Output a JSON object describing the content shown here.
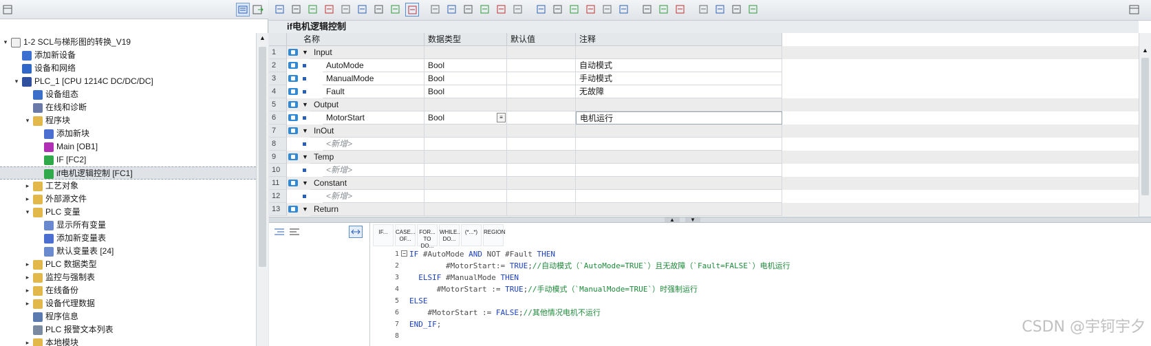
{
  "left_pane": {
    "tree": [
      {
        "label": "1-2 SCL与梯形图的转换_V19",
        "level": 0,
        "expander": "▾",
        "icon": "project-icon",
        "icon_color": "#f0f0f0"
      },
      {
        "label": "添加新设备",
        "level": 1,
        "expander": "",
        "icon": "add-device-icon",
        "icon_color": "#3b6fd0"
      },
      {
        "label": "设备和网络",
        "level": 1,
        "expander": "",
        "icon": "network-icon",
        "icon_color": "#2f68c8"
      },
      {
        "label": "PLC_1 [CPU 1214C DC/DC/DC]",
        "level": 1,
        "expander": "▾",
        "icon": "plc-icon",
        "icon_color": "#2f4f9f"
      },
      {
        "label": "设备组态",
        "level": 2,
        "expander": "",
        "icon": "device-config-icon",
        "icon_color": "#3c6fc9"
      },
      {
        "label": "在线和诊断",
        "level": 2,
        "expander": "",
        "icon": "diagnostics-icon",
        "icon_color": "#6a7aa8"
      },
      {
        "label": "程序块",
        "level": 2,
        "expander": "▾",
        "icon": "folder-icon",
        "icon_color": "#e2b84a"
      },
      {
        "label": "添加新块",
        "level": 3,
        "expander": "",
        "icon": "add-block-icon",
        "icon_color": "#4a6fd0"
      },
      {
        "label": "Main [OB1]",
        "level": 3,
        "expander": "",
        "icon": "ob-block-icon",
        "icon_color": "#b02fb5"
      },
      {
        "label": "IF [FC2]",
        "level": 3,
        "expander": "",
        "icon": "fc-block-icon",
        "icon_color": "#2fa94a"
      },
      {
        "label": "if电机逻辑控制 [FC1]",
        "level": 3,
        "expander": "",
        "icon": "fc-block-icon",
        "icon_color": "#2fa94a",
        "selected": true
      },
      {
        "label": "工艺对象",
        "level": 2,
        "expander": "▸",
        "icon": "folder-icon",
        "icon_color": "#e2b84a"
      },
      {
        "label": "外部源文件",
        "level": 2,
        "expander": "▸",
        "icon": "folder-icon",
        "icon_color": "#e2b84a"
      },
      {
        "label": "PLC 变量",
        "level": 2,
        "expander": "▾",
        "icon": "folder-icon",
        "icon_color": "#e2b84a"
      },
      {
        "label": "显示所有变量",
        "level": 3,
        "expander": "",
        "icon": "tag-table-icon",
        "icon_color": "#6a8ad0"
      },
      {
        "label": "添加新变量表",
        "level": 3,
        "expander": "",
        "icon": "add-tag-table-icon",
        "icon_color": "#4a6fd0"
      },
      {
        "label": "默认变量表 [24]",
        "level": 3,
        "expander": "",
        "icon": "tag-table-icon",
        "icon_color": "#6a8ad0"
      },
      {
        "label": "PLC 数据类型",
        "level": 2,
        "expander": "▸",
        "icon": "folder-icon",
        "icon_color": "#e2b84a"
      },
      {
        "label": "监控与强制表",
        "level": 2,
        "expander": "▸",
        "icon": "folder-icon",
        "icon_color": "#e2b84a"
      },
      {
        "label": "在线备份",
        "level": 2,
        "expander": "▸",
        "icon": "folder-icon",
        "icon_color": "#e2b84a"
      },
      {
        "label": "设备代理数据",
        "level": 2,
        "expander": "▸",
        "icon": "folder-icon",
        "icon_color": "#e2b84a"
      },
      {
        "label": "程序信息",
        "level": 2,
        "expander": "",
        "icon": "program-info-icon",
        "icon_color": "#5a7ab0"
      },
      {
        "label": "PLC 报警文本列表",
        "level": 2,
        "expander": "",
        "icon": "alarm-text-icon",
        "icon_color": "#7a8aa0"
      },
      {
        "label": "本地模块",
        "level": 2,
        "expander": "▸",
        "icon": "folder-icon",
        "icon_color": "#e2b84a"
      }
    ]
  },
  "block": {
    "title": "if电机逻辑控制"
  },
  "interface_table": {
    "headers": {
      "name": "名称",
      "datatype": "数据类型",
      "default": "默认值",
      "comment": "注释"
    },
    "rows": [
      {
        "num": "1",
        "type": "section",
        "name": "Input",
        "datatype": "",
        "comment": ""
      },
      {
        "num": "2",
        "type": "var",
        "name": "AutoMode",
        "datatype": "Bool",
        "comment": "自动模式"
      },
      {
        "num": "3",
        "type": "var",
        "name": "ManualMode",
        "datatype": "Bool",
        "comment": "手动模式"
      },
      {
        "num": "4",
        "type": "var",
        "name": "Fault",
        "datatype": "Bool",
        "comment": "无故障"
      },
      {
        "num": "5",
        "type": "section",
        "name": "Output",
        "datatype": "",
        "comment": ""
      },
      {
        "num": "6",
        "type": "var",
        "name": "MotorStart",
        "datatype": "Bool",
        "comment": "电机运行",
        "editing": true
      },
      {
        "num": "7",
        "type": "section",
        "name": "InOut",
        "datatype": "",
        "comment": ""
      },
      {
        "num": "8",
        "type": "new",
        "name": "<新增>",
        "datatype": "",
        "comment": ""
      },
      {
        "num": "9",
        "type": "section",
        "name": "Temp",
        "datatype": "",
        "comment": ""
      },
      {
        "num": "10",
        "type": "new",
        "name": "<新增>",
        "datatype": "",
        "comment": ""
      },
      {
        "num": "11",
        "type": "section",
        "name": "Constant",
        "datatype": "",
        "comment": ""
      },
      {
        "num": "12",
        "type": "new",
        "name": "<新增>",
        "datatype": "",
        "comment": ""
      },
      {
        "num": "13",
        "type": "section",
        "name": "Return",
        "datatype": "",
        "comment": ""
      }
    ]
  },
  "editor": {
    "instructions": [
      "IF...",
      "CASE... OF...",
      "FOR... TO DO...",
      "WHILE.. DO...",
      "(*...*)",
      "REGION"
    ],
    "lines": [
      {
        "num": "1",
        "parts": [
          [
            "kw",
            "IF "
          ],
          [
            "var",
            "#AutoMode "
          ],
          [
            "kw",
            "AND "
          ],
          [
            "var",
            "NOT "
          ],
          [
            "var",
            "#Fault "
          ],
          [
            "kw",
            "THEN"
          ]
        ]
      },
      {
        "num": "2",
        "parts": [
          [
            "var",
            "        #MotorStart"
          ],
          [
            "var",
            ":= "
          ],
          [
            "kw",
            "TRUE"
          ],
          [
            "var",
            ";"
          ],
          [
            "cm",
            "//自动模式（`AutoMode=TRUE`）且无故障（`Fault=FALSE`）电机运行"
          ]
        ]
      },
      {
        "num": "3",
        "parts": [
          [
            "kw",
            "  ELSIF "
          ],
          [
            "var",
            "#ManualMode "
          ],
          [
            "kw",
            "THEN"
          ]
        ]
      },
      {
        "num": "4",
        "parts": [
          [
            "var",
            "      #MotorStart "
          ],
          [
            "var",
            ":= "
          ],
          [
            "kw",
            "TRUE"
          ],
          [
            "var",
            ";"
          ],
          [
            "cm",
            "//手动模式（`ManualMode=TRUE`）时强制运行"
          ]
        ]
      },
      {
        "num": "5",
        "parts": [
          [
            "kw",
            "ELSE"
          ]
        ]
      },
      {
        "num": "6",
        "parts": [
          [
            "var",
            "    #MotorStart "
          ],
          [
            "var",
            ":= "
          ],
          [
            "kw",
            "FALSE"
          ],
          [
            "var",
            ";"
          ],
          [
            "cm",
            "//其他情况电机不运行"
          ]
        ]
      },
      {
        "num": "7",
        "parts": [
          [
            "kw",
            "END_IF"
          ],
          [
            "var",
            ";"
          ]
        ]
      },
      {
        "num": "8",
        "parts": []
      }
    ]
  },
  "watermark": "CSDN @宇钶宇夕",
  "colors": {
    "accent": "#2e8ad8",
    "selection": "#dfe3e8",
    "keyword": "#1a3fc0",
    "comment": "#1e8a3a"
  }
}
